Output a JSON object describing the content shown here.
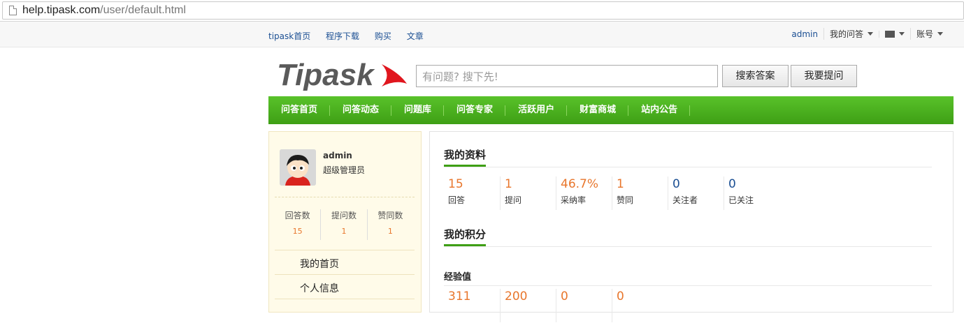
{
  "browser": {
    "url_host": "help.tipask.com",
    "url_path": "/user/default.html"
  },
  "topbar": {
    "links": [
      "tipask首页",
      "程序下载",
      "购买",
      "文章"
    ],
    "user": "admin",
    "my_questions": "我的问答",
    "account": "账号"
  },
  "header": {
    "logo_text": "Tipask",
    "search_placeholder": "有问题? 搜下先!",
    "search_button": "搜索答案",
    "ask_button": "我要提问"
  },
  "nav": [
    "问答首页",
    "问答动态",
    "问题库",
    "问答专家",
    "活跃用户",
    "财富商城",
    "站内公告"
  ],
  "profile": {
    "name": "admin",
    "role": "超级管理员",
    "stats": [
      {
        "label": "回答数",
        "value": "15"
      },
      {
        "label": "提问数",
        "value": "1"
      },
      {
        "label": "赞同数",
        "value": "1"
      }
    ],
    "menu": [
      "我的首页",
      "个人信息"
    ]
  },
  "my_info": {
    "title": "我的资料",
    "stats": [
      {
        "value": "15",
        "label": "回答",
        "color": "#e8762c"
      },
      {
        "value": "1",
        "label": "提问",
        "color": "#e8762c"
      },
      {
        "value": "46.7%",
        "label": "采纳率",
        "color": "#e8762c"
      },
      {
        "value": "1",
        "label": "赞同",
        "color": "#e8762c"
      },
      {
        "value": "0",
        "label": "关注者",
        "color": "#1b4f93"
      },
      {
        "value": "0",
        "label": "已关注",
        "color": "#1b4f93"
      }
    ]
  },
  "my_points": {
    "title": "我的积分",
    "exp_label": "经验值",
    "exp_values": [
      "311",
      "200",
      "0",
      "0"
    ]
  },
  "colors": {
    "accent_green": "#4caf1e",
    "orange": "#e8762c",
    "link_blue": "#1b4f93"
  }
}
